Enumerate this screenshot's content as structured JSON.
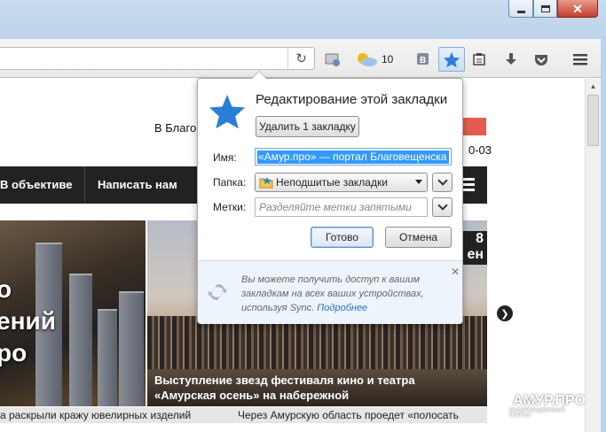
{
  "toolbar": {
    "weather_temp": "10"
  },
  "page": {
    "city": "В Благо",
    "date": "0-03",
    "nav": [
      "В объективе",
      "Написать нам"
    ],
    "hero_left_text": "о\nений\nро",
    "hero_caption": "Выступление звезд фестиваля кино и театра «Амурская осень» на набережной",
    "hero_date": "8\nен",
    "ticker": [
      "а раскрыли кражу ювелирных изделий",
      "Через Амурскую область проедет «полосать"
    ],
    "watermark": "АМУР.ПРО",
    "watermark_sub": "ИНФОРМАЦИОННЫЙ ПОРТАЛ"
  },
  "bookmark_panel": {
    "title": "Редактирование этой закладки",
    "remove_button": "Удалить 1 закладку",
    "name_label": "Имя:",
    "name_value": "«Амур.про» — портал Благовещенска и Приамурья",
    "folder_label": "Папка:",
    "folder_value": "Неподшитые закладки",
    "tags_label": "Метки:",
    "tags_placeholder": "Разделяйте метки запятыми",
    "done_button": "Готово",
    "cancel_button": "Отмена",
    "sync_text": "Вы можете получить доступ к вашим закладкам на всех ваших устройствах, используя Sync.",
    "sync_link": "Подробнее"
  },
  "colors": {
    "accent_blue": "#2a7fd4",
    "nav_bg": "#222222",
    "badge_red": "#e35d4f"
  }
}
